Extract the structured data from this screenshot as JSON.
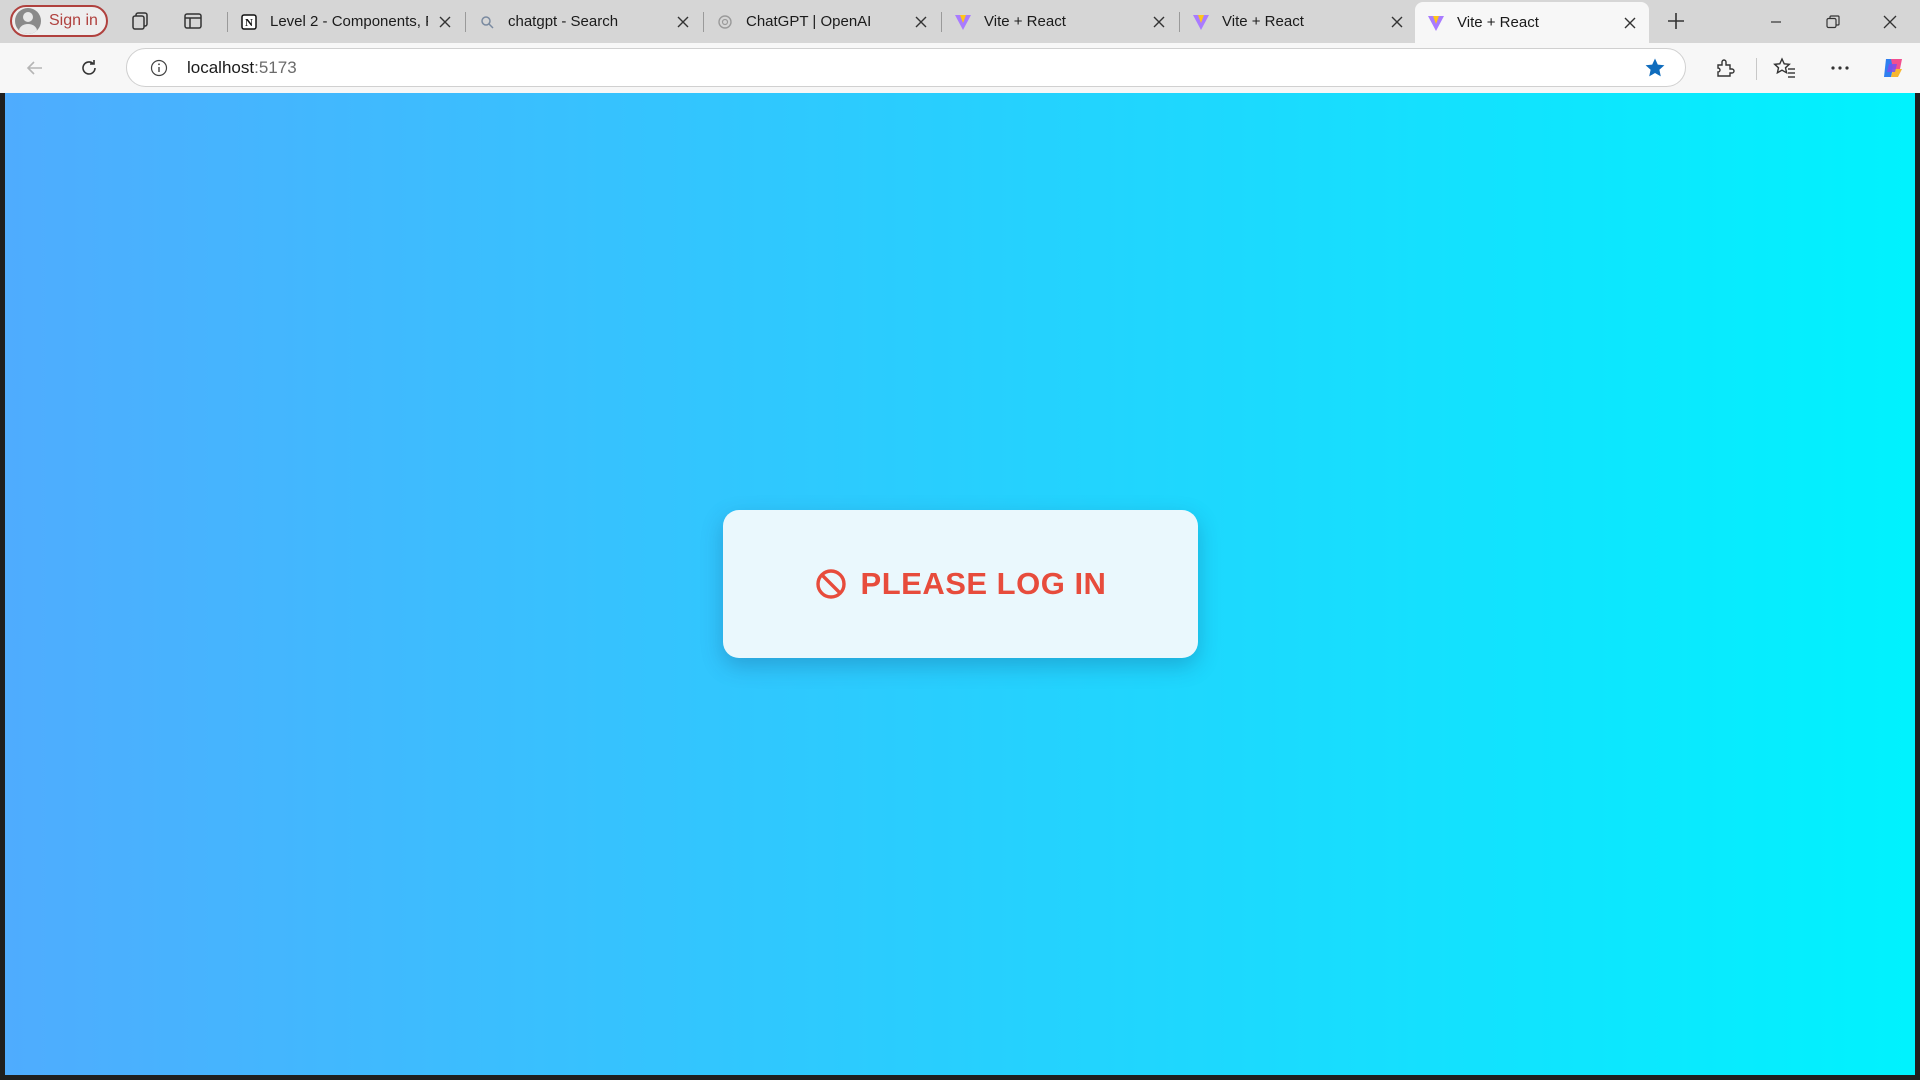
{
  "browser": {
    "signin_label": "Sign in",
    "tabs": [
      {
        "title": "Level 2 - Components, P",
        "favicon": "notion-icon"
      },
      {
        "title": "chatgpt - Search",
        "favicon": "search-icon"
      },
      {
        "title": "ChatGPT | OpenAI",
        "favicon": "openai-icon"
      },
      {
        "title": "Vite + React",
        "favicon": "vite-icon"
      },
      {
        "title": "Vite + React",
        "favicon": "vite-icon"
      },
      {
        "title": "Vite + React",
        "favicon": "vite-icon",
        "active": true
      }
    ],
    "address": {
      "host": "localhost",
      "port": ":5173"
    },
    "accent_color": "#0f6cbd"
  },
  "page": {
    "message": "PLEASE LOG IN",
    "message_color": "#e74c3c",
    "gradient_start": "#4facfe",
    "gradient_end": "#00f2fe",
    "icon": "prohibited-icon"
  }
}
